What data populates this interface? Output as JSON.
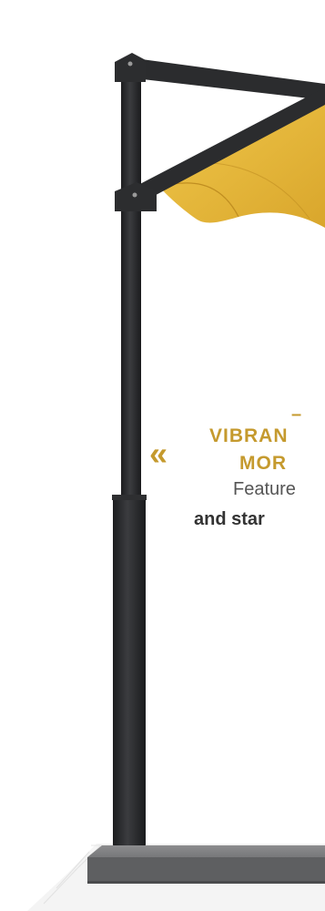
{
  "colors": {
    "accent": "#c59a2e",
    "pole": "#2a2b2d",
    "canopy": "#e3b23a",
    "text_gray": "#555555",
    "text_dark": "#333333"
  },
  "icons": {
    "quote_mark": "double-chevron-left-icon"
  },
  "product_image": {
    "alt": "cantilever umbrella with yellow canopy on black pole and gray base"
  },
  "feature": {
    "dash": "–",
    "heading_line1": "VIBRAN",
    "heading_line2": "MOR",
    "quote_glyph": "«",
    "text_line1": "Feature",
    "text_line2": "and star"
  }
}
